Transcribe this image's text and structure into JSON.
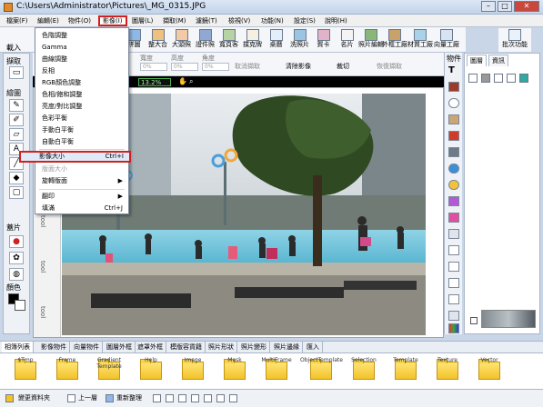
{
  "window": {
    "title": "C:\\Users\\Administrator\\Pictures\\_MG_0315.JPG",
    "btn_min": "–",
    "btn_max": "□",
    "btn_close": "✕"
  },
  "menu": [
    {
      "label": "檔案(F)"
    },
    {
      "label": "編輯(E)"
    },
    {
      "label": "物件(O)"
    },
    {
      "label": "影像(I)"
    },
    {
      "label": "圖層(L)"
    },
    {
      "label": "擷取(M)"
    },
    {
      "label": "濾鏡(T)"
    },
    {
      "label": "檢視(V)"
    },
    {
      "label": "功能(N)"
    },
    {
      "label": "設定(S)"
    },
    {
      "label": "說明(H)"
    }
  ],
  "toolbar": [
    "拼圖",
    "整大合",
    "大頭照",
    "證件照",
    "寬頁客",
    "撲克牌",
    "桌曆",
    "洗照片",
    "賀卡",
    "名片",
    "照片編輯",
    "外框工廠",
    "材質工廠",
    "向量工廠",
    "批次功能"
  ],
  "left_panel": {
    "file_label": "載入",
    "select_label": "擷取",
    "draw_label": "繪圖",
    "stamp_label": "蓋片",
    "color_label": "顏色"
  },
  "options": {
    "width_label": "寬度",
    "height_label": "高度",
    "angle_label": "角度",
    "width_value": "0%",
    "height_value": "0%",
    "angle_value": "0%",
    "cancel_label": "取消擷取",
    "clear_label": "清除影像",
    "crop_label": "裁切",
    "restore_label": "恢復擷取"
  },
  "zoom": "13.2%",
  "ruler_text": "tool",
  "image_menu": [
    {
      "label": "色階調整",
      "shortcut": "",
      "disabled": false
    },
    {
      "label": "Gamma",
      "shortcut": "",
      "disabled": false
    },
    {
      "label": "曲線調整",
      "shortcut": "",
      "disabled": false
    },
    {
      "label": "反相",
      "shortcut": "",
      "disabled": false
    },
    {
      "label": "RGB顏色調整",
      "shortcut": "",
      "disabled": false
    },
    {
      "label": "色相/飽和調整",
      "shortcut": "",
      "disabled": false
    },
    {
      "label": "亮度/對比調整",
      "shortcut": "",
      "disabled": false
    },
    {
      "label": "色彩平衡",
      "shortcut": "",
      "disabled": false
    },
    {
      "label": "手動白平衡",
      "shortcut": "",
      "disabled": false
    },
    {
      "label": "自動白平衡",
      "shortcut": "",
      "disabled": false
    },
    {
      "label": "影像大小",
      "shortcut": "Ctrl+I",
      "disabled": false,
      "highlight": true
    },
    {
      "label": "版面大小",
      "shortcut": "",
      "disabled": true
    },
    {
      "label": "旋轉版面",
      "shortcut": "▶",
      "disabled": false
    },
    {
      "label": "翻印",
      "shortcut": "▶",
      "disabled": false
    },
    {
      "label": "填滿",
      "shortcut": "Ctrl+J",
      "disabled": false
    }
  ],
  "right_panel": {
    "objects_label": "物件",
    "tab_layers": "圖層",
    "tab_info": "資訊"
  },
  "bottom_tabs": [
    "相簿列表",
    "影像物件",
    "向量物件",
    "圖層外框",
    "遮罩外框",
    "模版容貨籍",
    "照片形狀",
    "照片變形",
    "照片邊緣",
    "匯入"
  ],
  "folders": [
    "$Tmp",
    "Frame",
    "Gradient Template",
    "Help",
    "Image",
    "Mask",
    "MultiFrame",
    "ObjectTemplate",
    "Selection",
    "Template",
    "Texture",
    "Vector"
  ],
  "status": {
    "change_folder": "變更資料夾",
    "up": "上一層",
    "refresh": "重新整理"
  },
  "colors": {
    "accent_red": "#d21f1f",
    "menu_highlight": "#dfeaf8",
    "zoom_green": "#4caf50"
  }
}
